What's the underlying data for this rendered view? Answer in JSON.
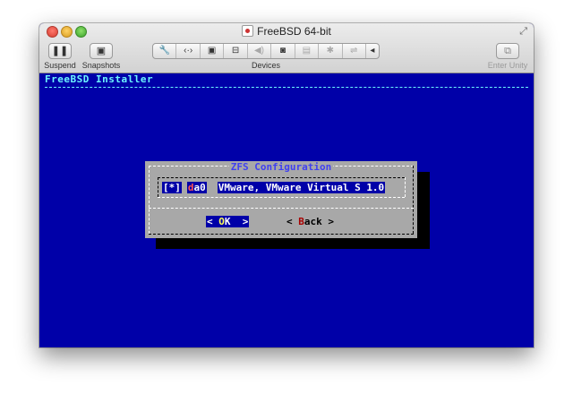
{
  "window": {
    "title": "FreeBSD 64-bit"
  },
  "toolbar": {
    "suspend_label": "Suspend",
    "snapshots_label": "Snapshots",
    "devices_label": "Devices",
    "enter_unity_label": "Enter Unity",
    "devices": [
      {
        "icon": "wrench-icon",
        "glyph": "🔧"
      },
      {
        "icon": "network-arrows-icon",
        "glyph": "⟨·⟩"
      },
      {
        "icon": "cd-drive-icon",
        "glyph": "▣"
      },
      {
        "icon": "hard-disk-icon",
        "glyph": "⊟"
      },
      {
        "icon": "sound-icon",
        "glyph": "🔊"
      },
      {
        "icon": "camera-icon",
        "glyph": "◙"
      },
      {
        "icon": "printer-icon",
        "glyph": "▤"
      },
      {
        "icon": "bluetooth-icon",
        "glyph": "✱"
      },
      {
        "icon": "usb-icon",
        "glyph": "⇌"
      },
      {
        "icon": "chevron-left-icon",
        "glyph": "◂"
      }
    ]
  },
  "installer": {
    "title": "FreeBSD Installer"
  },
  "dialog": {
    "title": "ZFS Configuration",
    "row": {
      "checkbox": "[*]",
      "device_first": "d",
      "device_rest": "a0",
      "description": "VMware, VMware Virtual S 1.0"
    },
    "ok_button": {
      "left": "< ",
      "hot": "O",
      "rest": "K",
      "right": "  >"
    },
    "back_button": {
      "left": "< ",
      "hot": "B",
      "rest": "ack",
      "right": " >"
    }
  },
  "colors": {
    "console_blue": "#0000a8",
    "dialog_gray": "#a8a8a8",
    "title_cyan": "#6cf6ff",
    "dialog_title": "#4040f0",
    "hotkey_red": "#a80000"
  }
}
